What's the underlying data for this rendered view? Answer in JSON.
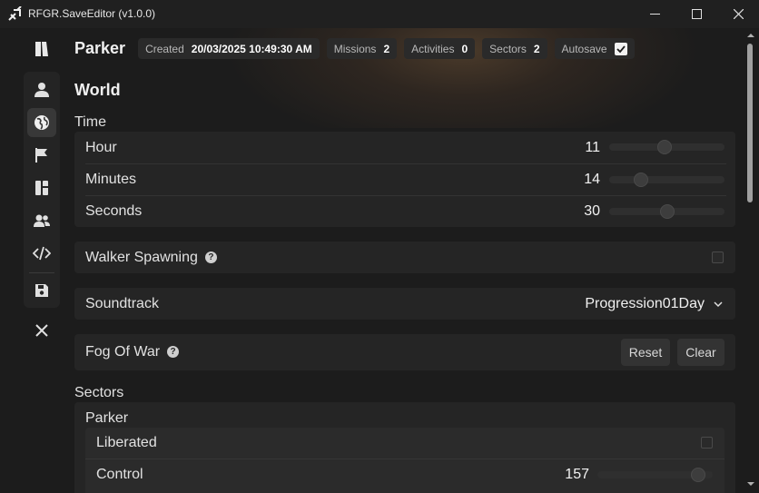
{
  "window": {
    "title": "RFGR.SaveEditor (v1.0.0)"
  },
  "header": {
    "save_name": "Parker",
    "created_label": "Created",
    "created_value": "20/03/2025 10:49:30 AM",
    "missions_label": "Missions",
    "missions_value": "2",
    "activities_label": "Activities",
    "activities_value": "0",
    "sectors_label": "Sectors",
    "sectors_value": "2",
    "autosave_label": "Autosave",
    "autosave_checked": true
  },
  "sidebar": {
    "items": [
      {
        "icon": "user-icon",
        "active": false
      },
      {
        "icon": "globe-icon",
        "active": true
      },
      {
        "icon": "flag-icon",
        "active": false
      },
      {
        "icon": "columns-icon",
        "active": false
      },
      {
        "icon": "users-icon",
        "active": false
      },
      {
        "icon": "code-icon",
        "active": false
      },
      {
        "icon": "save-icon",
        "active": false
      }
    ]
  },
  "world": {
    "title": "World",
    "time_label": "Time",
    "hour_label": "Hour",
    "hour_value": "11",
    "hour_fraction": 0.48,
    "minutes_label": "Minutes",
    "minutes_value": "14",
    "minutes_fraction": 0.24,
    "seconds_label": "Seconds",
    "seconds_value": "30",
    "seconds_fraction": 0.5,
    "walker_spawning_label": "Walker Spawning",
    "walker_spawning_checked": false,
    "soundtrack_label": "Soundtrack",
    "soundtrack_value": "Progression01Day",
    "fog_label": "Fog Of War",
    "fog_reset": "Reset",
    "fog_clear": "Clear",
    "help_glyph": "?"
  },
  "sectors": {
    "title": "Sectors",
    "items": [
      {
        "name": "Parker",
        "liberated_label": "Liberated",
        "liberated_checked": false,
        "control_label": "Control",
        "control_value": "157",
        "control_fraction": 0.93
      }
    ]
  }
}
